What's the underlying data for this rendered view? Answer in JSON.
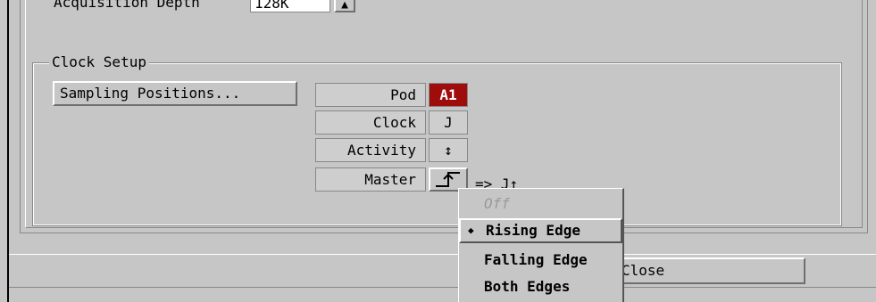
{
  "acquisition": {
    "label": "Acquisition Depth",
    "value": "128K",
    "dropdown_icon": "dropdown-arrow-icon"
  },
  "clock_setup": {
    "title": "Clock Setup",
    "sampling_button": "Sampling Positions...",
    "rows": {
      "pod": {
        "label": "Pod",
        "value": "A1"
      },
      "clock": {
        "label": "Clock",
        "value": "J"
      },
      "activity": {
        "label": "Activity",
        "value": "↕"
      },
      "master": {
        "label": "Master",
        "value": "rising-edge-icon",
        "result": "=> J↑"
      }
    }
  },
  "close_button": "Close",
  "edge_menu": {
    "items": [
      "Off",
      "Rising Edge",
      "Falling Edge",
      "Both Edges"
    ],
    "selected": "Rising Edge"
  },
  "colors": {
    "pod_value_bg": "#9e0c0c",
    "background": "#c6c6c6"
  }
}
